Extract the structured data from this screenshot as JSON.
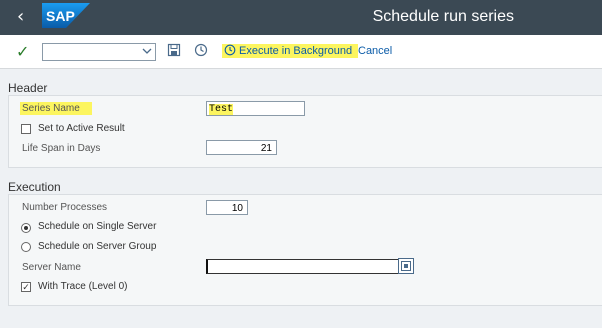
{
  "header": {
    "brand": "SAP",
    "title": "Schedule run series"
  },
  "toolbar": {
    "combo_value": "",
    "execute_label": "Execute in Background",
    "cancel_label": "Cancel"
  },
  "header_section": {
    "label": "Header",
    "series_name_label": "Series Name",
    "series_name_value": "Test",
    "set_active_label": "Set to Active Result",
    "set_active_checked": false,
    "life_span_label": "Life Span in Days",
    "life_span_value": "21"
  },
  "execution_section": {
    "label": "Execution",
    "number_processes_label": "Number Processes",
    "number_processes_value": "10",
    "single_server_label": "Schedule on Single Server",
    "server_group_label": "Schedule on Server Group",
    "selected_option": "single_server",
    "server_name_label": "Server Name",
    "server_name_value": "",
    "with_trace_label": "With Trace (Level 0)",
    "with_trace_checked": true
  },
  "colors": {
    "title_bar": "#3b4954",
    "highlight": "#fcf55f",
    "link": "#0a5ba8",
    "sap_blue": "#0a6ed1"
  }
}
